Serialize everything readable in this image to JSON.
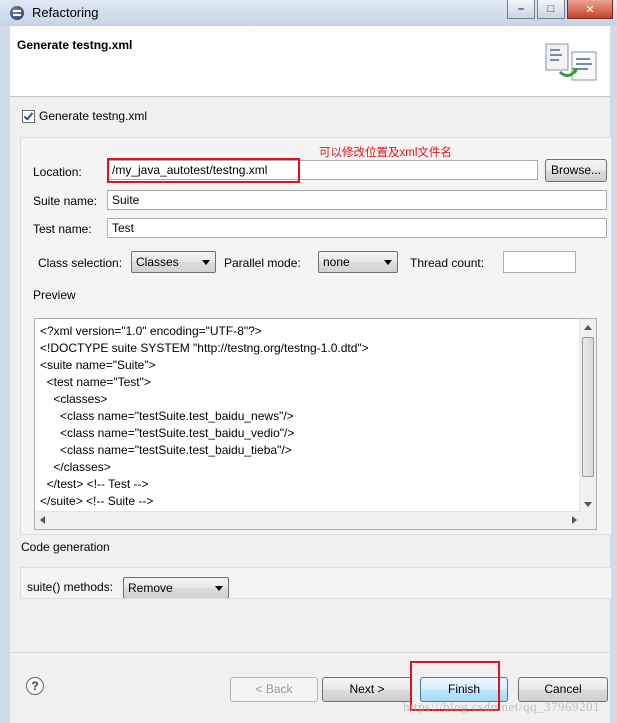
{
  "window": {
    "title": "Refactoring",
    "minimize": "–",
    "maximize": "□",
    "close": "✕"
  },
  "header": {
    "title": "Generate testng.xml"
  },
  "generate_checkbox": {
    "label": "Generate testng.xml",
    "checked": true
  },
  "annotation": "可以修改位置及xml文件名",
  "location": {
    "label": "Location:",
    "value": "/my_java_autotest/testng.xml",
    "browse": "Browse..."
  },
  "suite": {
    "label": "Suite name:",
    "value": "Suite"
  },
  "test": {
    "label": "Test name:",
    "value": "Test"
  },
  "class_selection": {
    "label": "Class selection:",
    "value": "Classes"
  },
  "parallel_mode": {
    "label": "Parallel mode:",
    "value": "none"
  },
  "thread_count": {
    "label": "Thread count:",
    "value": ""
  },
  "preview": {
    "label": "Preview",
    "lines": [
      "<?xml version=\"1.0\" encoding=\"UTF-8\"?>",
      "<!DOCTYPE suite SYSTEM \"http://testng.org/testng-1.0.dtd\">",
      "<suite name=\"Suite\">",
      "  <test name=\"Test\">",
      "    <classes>",
      "      <class name=\"testSuite.test_baidu_news\"/>",
      "      <class name=\"testSuite.test_baidu_vedio\"/>",
      "      <class name=\"testSuite.test_baidu_tieba\"/>",
      "    </classes>",
      "  </test> <!-- Test -->",
      "</suite> <!-- Suite -->"
    ]
  },
  "code_generation": {
    "label": "Code generation",
    "suite_methods_label": "suite() methods:",
    "suite_methods_value": "Remove"
  },
  "buttons": {
    "help": "?",
    "back": "< Back",
    "next": "Next >",
    "finish": "Finish",
    "cancel": "Cancel"
  },
  "watermark": "https://blog.csdn.net/qq_37969201"
}
